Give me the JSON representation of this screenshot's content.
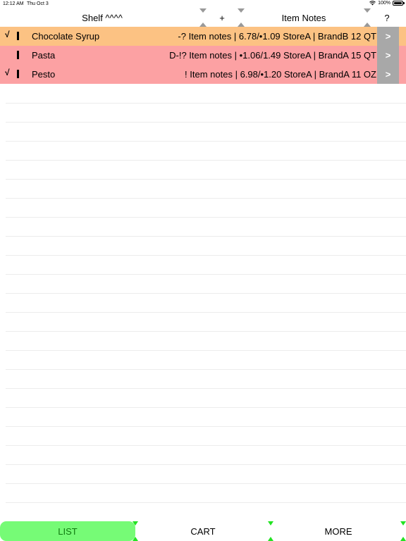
{
  "status_bar": {
    "time": "12:12 AM",
    "date": "Thu Oct 3",
    "battery": "100%"
  },
  "header": {
    "shelf_label": "Shelf ^^^^",
    "add_label": "+",
    "notes_label": "Item Notes",
    "help_label": "?"
  },
  "items": [
    {
      "check": "√",
      "name": "Chocolate Syrup",
      "notes": "-? Item notes | 6.78/•1.09 StoreA | BrandB 12 QT",
      "arrow": ">",
      "color": "#fcc283"
    },
    {
      "check": "",
      "name": "Pasta",
      "notes": "D-!? Item notes | •1.06/1.49 StoreA | BrandA 15 QT",
      "arrow": ">",
      "color": "#fca1a3"
    },
    {
      "check": "√",
      "name": "Pesto",
      "notes": "! Item notes | 6.98/•1.20 StoreA | BrandA 11 OZ",
      "arrow": ">",
      "color": "#fca1a3"
    }
  ],
  "footer": {
    "list_label": "LIST",
    "cart_label": "CART",
    "more_label": "MORE"
  },
  "colors": {
    "orange_row": "#fcc283",
    "pink_row": "#fca1a3",
    "active_tab": "#76fb76",
    "accent_green": "#22e322"
  }
}
